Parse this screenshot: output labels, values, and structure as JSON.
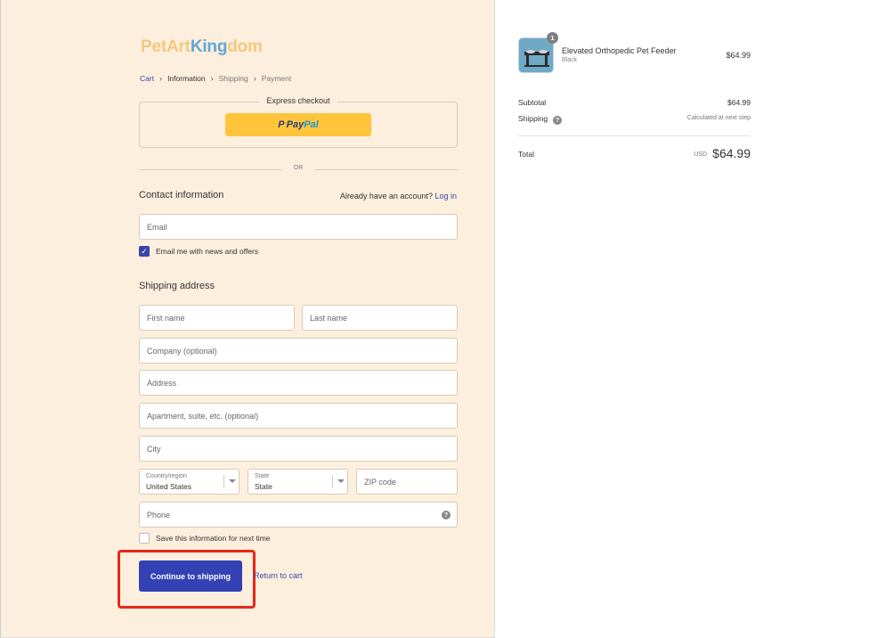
{
  "logo": {
    "part1": "Pet",
    "part2": "Art",
    "part3": "King",
    "part4": "dom"
  },
  "breadcrumb": {
    "items": [
      "Cart",
      "Information",
      "Shipping",
      "Payment"
    ],
    "separator": "›"
  },
  "express_checkout": {
    "title": "Express checkout",
    "paypal_mark": "P",
    "paypal_pay": "Pay",
    "paypal_pal": "Pal"
  },
  "divider_text": "OR",
  "contact": {
    "title": "Contact information",
    "account_prompt": "Already have an account?",
    "login_link": "Log in",
    "email_placeholder": "Email",
    "newsletter_label": "Email me with news and offers",
    "newsletter_checked": true
  },
  "shipping": {
    "title": "Shipping address",
    "first_name_placeholder": "First name",
    "last_name_placeholder": "Last name",
    "company_placeholder": "Company (optional)",
    "address_placeholder": "Address",
    "apartment_placeholder": "Apartment, suite, etc. (optional)",
    "city_placeholder": "City",
    "country_label": "Country/region",
    "country_value": "United States",
    "state_label": "State",
    "state_value": "State",
    "zip_placeholder": "ZIP code",
    "phone_placeholder": "Phone",
    "phone_help_icon": "?",
    "save_info_label": "Save this information for next time",
    "save_info_checked": false
  },
  "actions": {
    "continue_label": "Continue to shipping",
    "return_label": "Return to cart"
  },
  "order_summary": {
    "product": {
      "name": "Elevated Orthopedic Pet Feeder",
      "variant": "Black",
      "price": "$64.99",
      "quantity": "1"
    },
    "subtotal_label": "Subtotal",
    "subtotal_value": "$64.99",
    "shipping_label": "Shipping",
    "shipping_help_icon": "?",
    "shipping_value": "Calculated at next step",
    "total_label": "Total",
    "currency": "USD",
    "total_value": "$64.99"
  },
  "colors": {
    "left_bg": "#fdefde",
    "primary_button": "#3341b4",
    "link": "#3b44a8",
    "paypal_yellow": "#ffc43a",
    "highlight": "#e82617"
  }
}
